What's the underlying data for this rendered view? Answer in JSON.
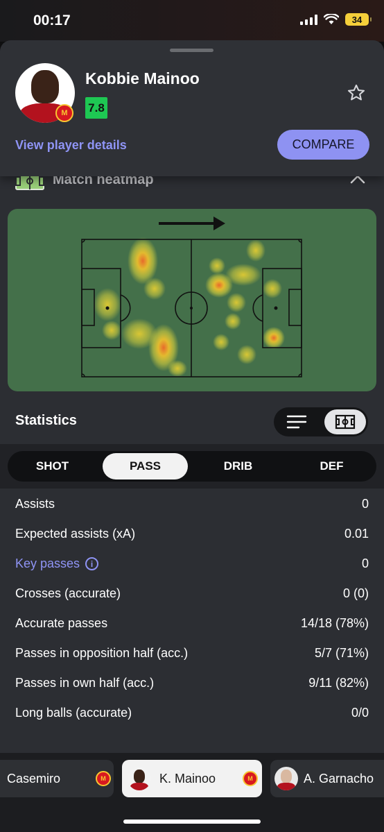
{
  "status_bar": {
    "time": "00:17",
    "battery": "34"
  },
  "header": {
    "player_name": "Kobbie Mainoo",
    "rating": "7.8",
    "rating_color": "#1ec853",
    "view_details_label": "View player details",
    "compare_label": "COMPARE",
    "favorite_icon": "star-outline-icon"
  },
  "heatmap": {
    "title": "Match heatmap",
    "attack_direction": "right"
  },
  "statistics": {
    "title": "Statistics",
    "tabs": [
      {
        "label": "SHOT",
        "active": false
      },
      {
        "label": "PASS",
        "active": true
      },
      {
        "label": "DRIB",
        "active": false
      },
      {
        "label": "DEF",
        "active": false
      }
    ],
    "rows": [
      {
        "label": "Assists",
        "value": "0"
      },
      {
        "label": "Expected assists (xA)",
        "value": "0.01"
      },
      {
        "label": "Key passes",
        "value": "0"
      },
      {
        "label": "Crosses (accurate)",
        "value": "0 (0)"
      },
      {
        "label": "Accurate passes",
        "value": "14/18 (78%)"
      },
      {
        "label": "Passes in opposition half (acc.)",
        "value": "5/7 (71%)"
      },
      {
        "label": "Passes in own half (acc.)",
        "value": "9/11 (82%)"
      },
      {
        "label": "Long balls (accurate)",
        "value": "0/0"
      }
    ]
  },
  "player_switcher": [
    {
      "name": "Casemiro",
      "active": false
    },
    {
      "name": "K. Mainoo",
      "active": true
    },
    {
      "name": "A. Garnacho",
      "active": false
    }
  ]
}
